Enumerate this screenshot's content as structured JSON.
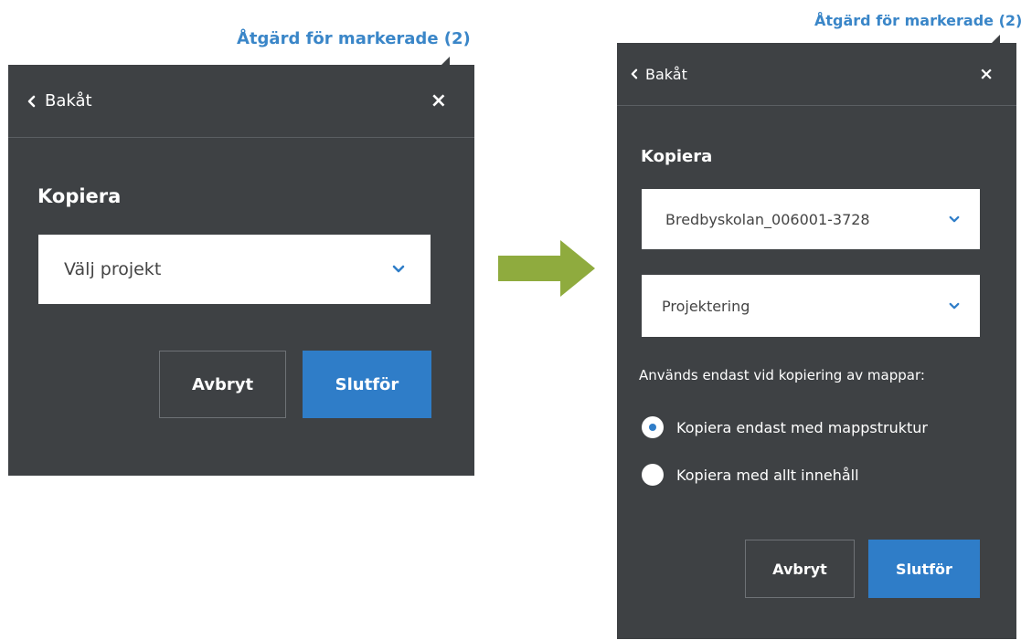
{
  "left_panel": {
    "trigger_label": "Åtgärd för markerade (2)",
    "back_label": "Bakåt",
    "close_symbol": "×",
    "heading": "Kopiera",
    "project_select": {
      "value": "Välj projekt"
    },
    "cancel_label": "Avbryt",
    "finish_label": "Slutför"
  },
  "right_panel": {
    "trigger_label": "Åtgärd för markerade (2)",
    "back_label": "Bakåt",
    "close_symbol": "×",
    "heading": "Kopiera",
    "project_select": {
      "value": "Bredbyskolan_006001-3728"
    },
    "folder_select": {
      "value": "Projektering"
    },
    "folder_note": "Används endast vid kopiering av mappar:",
    "copy_options": [
      {
        "label": "Kopiera endast med mappstruktur",
        "selected": true
      },
      {
        "label": "Kopiera med allt innehåll",
        "selected": false
      }
    ],
    "cancel_label": "Avbryt",
    "finish_label": "Slutför"
  },
  "icons": {
    "back": "chevron-left-icon",
    "close": "close-icon",
    "dropdown": "chevron-down-icon",
    "transition": "arrow-right-icon"
  },
  "colors": {
    "panel_bg": "#3e4144",
    "accent": "#2f7dc8",
    "link": "#3a86c8",
    "arrow": "#8fab3e"
  }
}
